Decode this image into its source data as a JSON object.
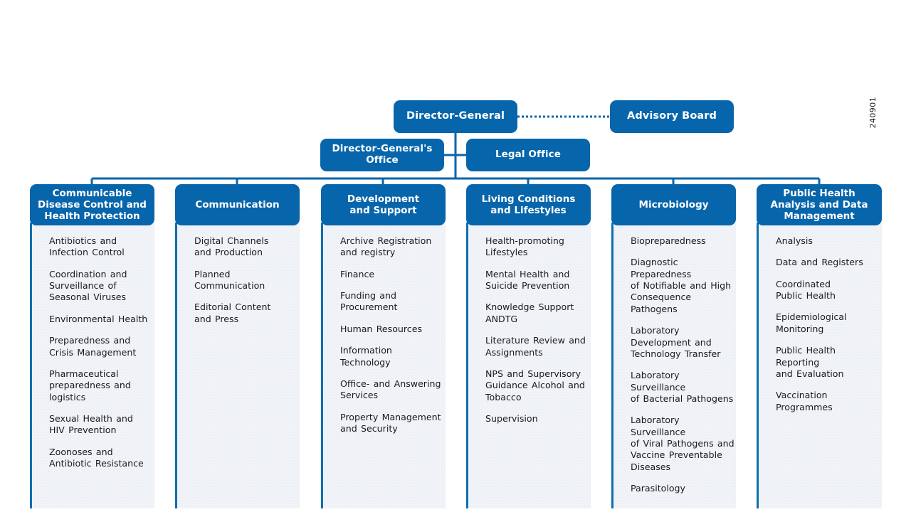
{
  "side_code": "240901",
  "colors": {
    "brand_blue": "#0765ab",
    "panel_bg": "#eef1f6",
    "panel_border": "#0b6fae",
    "connector": "#0765ab",
    "text": "#1a1a1a"
  },
  "top": {
    "director_general": "Director-General",
    "advisory_board": "Advisory Board",
    "dg_office": "Director-General's\nOffice",
    "legal_office": "Legal Office"
  },
  "departments": [
    {
      "title": "Communicable\nDisease Control and\nHealth Protection",
      "units": [
        "Antibiotics and\nInfection Control",
        "Coordination and\nSurveillance of\nSeasonal Viruses",
        "Environmental Health",
        "Preparedness and\nCrisis Management",
        "Pharmaceutical\npreparedness and\nlogistics",
        "Sexual Health and\nHIV Prevention",
        "Zoonoses and\nAntibiotic Resistance"
      ]
    },
    {
      "title": "Communication",
      "units": [
        "Digital Channels\nand Production",
        "Planned Communication",
        "Editorial Content\nand Press"
      ]
    },
    {
      "title": "Development\nand Support",
      "units": [
        "Archive Registration\nand registry",
        "Finance",
        "Funding and\nProcurement",
        "Human Resources",
        "Information Technology",
        "Office- and Answering\nServices",
        "Property Management\nand Security"
      ]
    },
    {
      "title": "Living Conditions\nand Lifestyles",
      "units": [
        "Health-promoting\nLifestyles",
        "Mental Health and\nSuicide Prevention",
        "Knowledge Support\nANDTG",
        "Literature Review and\nAssignments",
        "NPS and Supervisory\nGuidance Alcohol and\nTobacco",
        "Supervision"
      ]
    },
    {
      "title": "Microbiology",
      "units": [
        "Biopreparedness",
        "Diagnostic Preparedness\nof Notifiable and High\nConsequence Pathogens",
        "Laboratory\nDevelopment and\nTechnology Transfer",
        "Laboratory Surveillance\nof Bacterial Pathogens",
        "Laboratory Surveillance\nof Viral Pathogens and\nVaccine Preventable\nDiseases",
        "Parasitology"
      ]
    },
    {
      "title": "Public Health\nAnalysis and Data\nManagement",
      "units": [
        "Analysis",
        "Data and Registers",
        "Coordinated\nPublic Health",
        "Epidemiological\nMonitoring",
        "Public Health Reporting\nand Evaluation",
        "Vaccination\nProgrammes"
      ]
    }
  ]
}
